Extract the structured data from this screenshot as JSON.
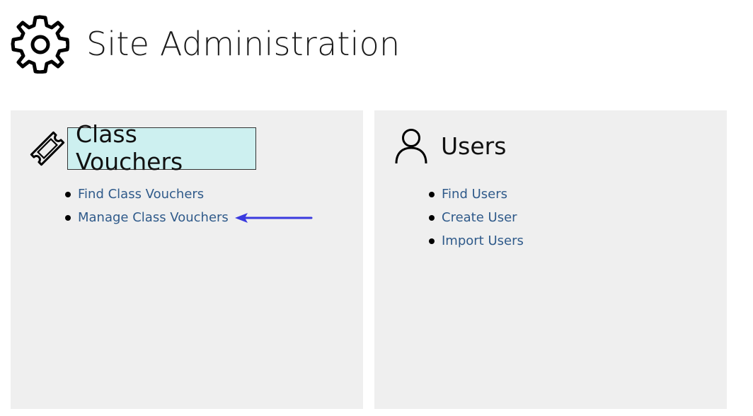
{
  "header": {
    "title": "Site Administration",
    "icon": "gear-icon"
  },
  "panels": [
    {
      "title": "Class Vouchers",
      "icon": "ticket-icon",
      "links": [
        "Find Class Vouchers",
        "Manage Class Vouchers"
      ]
    },
    {
      "title": "Users",
      "icon": "user-icon",
      "links": [
        "Find Users",
        "Create User",
        "Import Users"
      ]
    }
  ],
  "colors": {
    "panel_bg": "#efefef",
    "highlight_bg": "#cdf0f0",
    "link": "#2f5a8a",
    "arrow": "#3a3adf"
  }
}
